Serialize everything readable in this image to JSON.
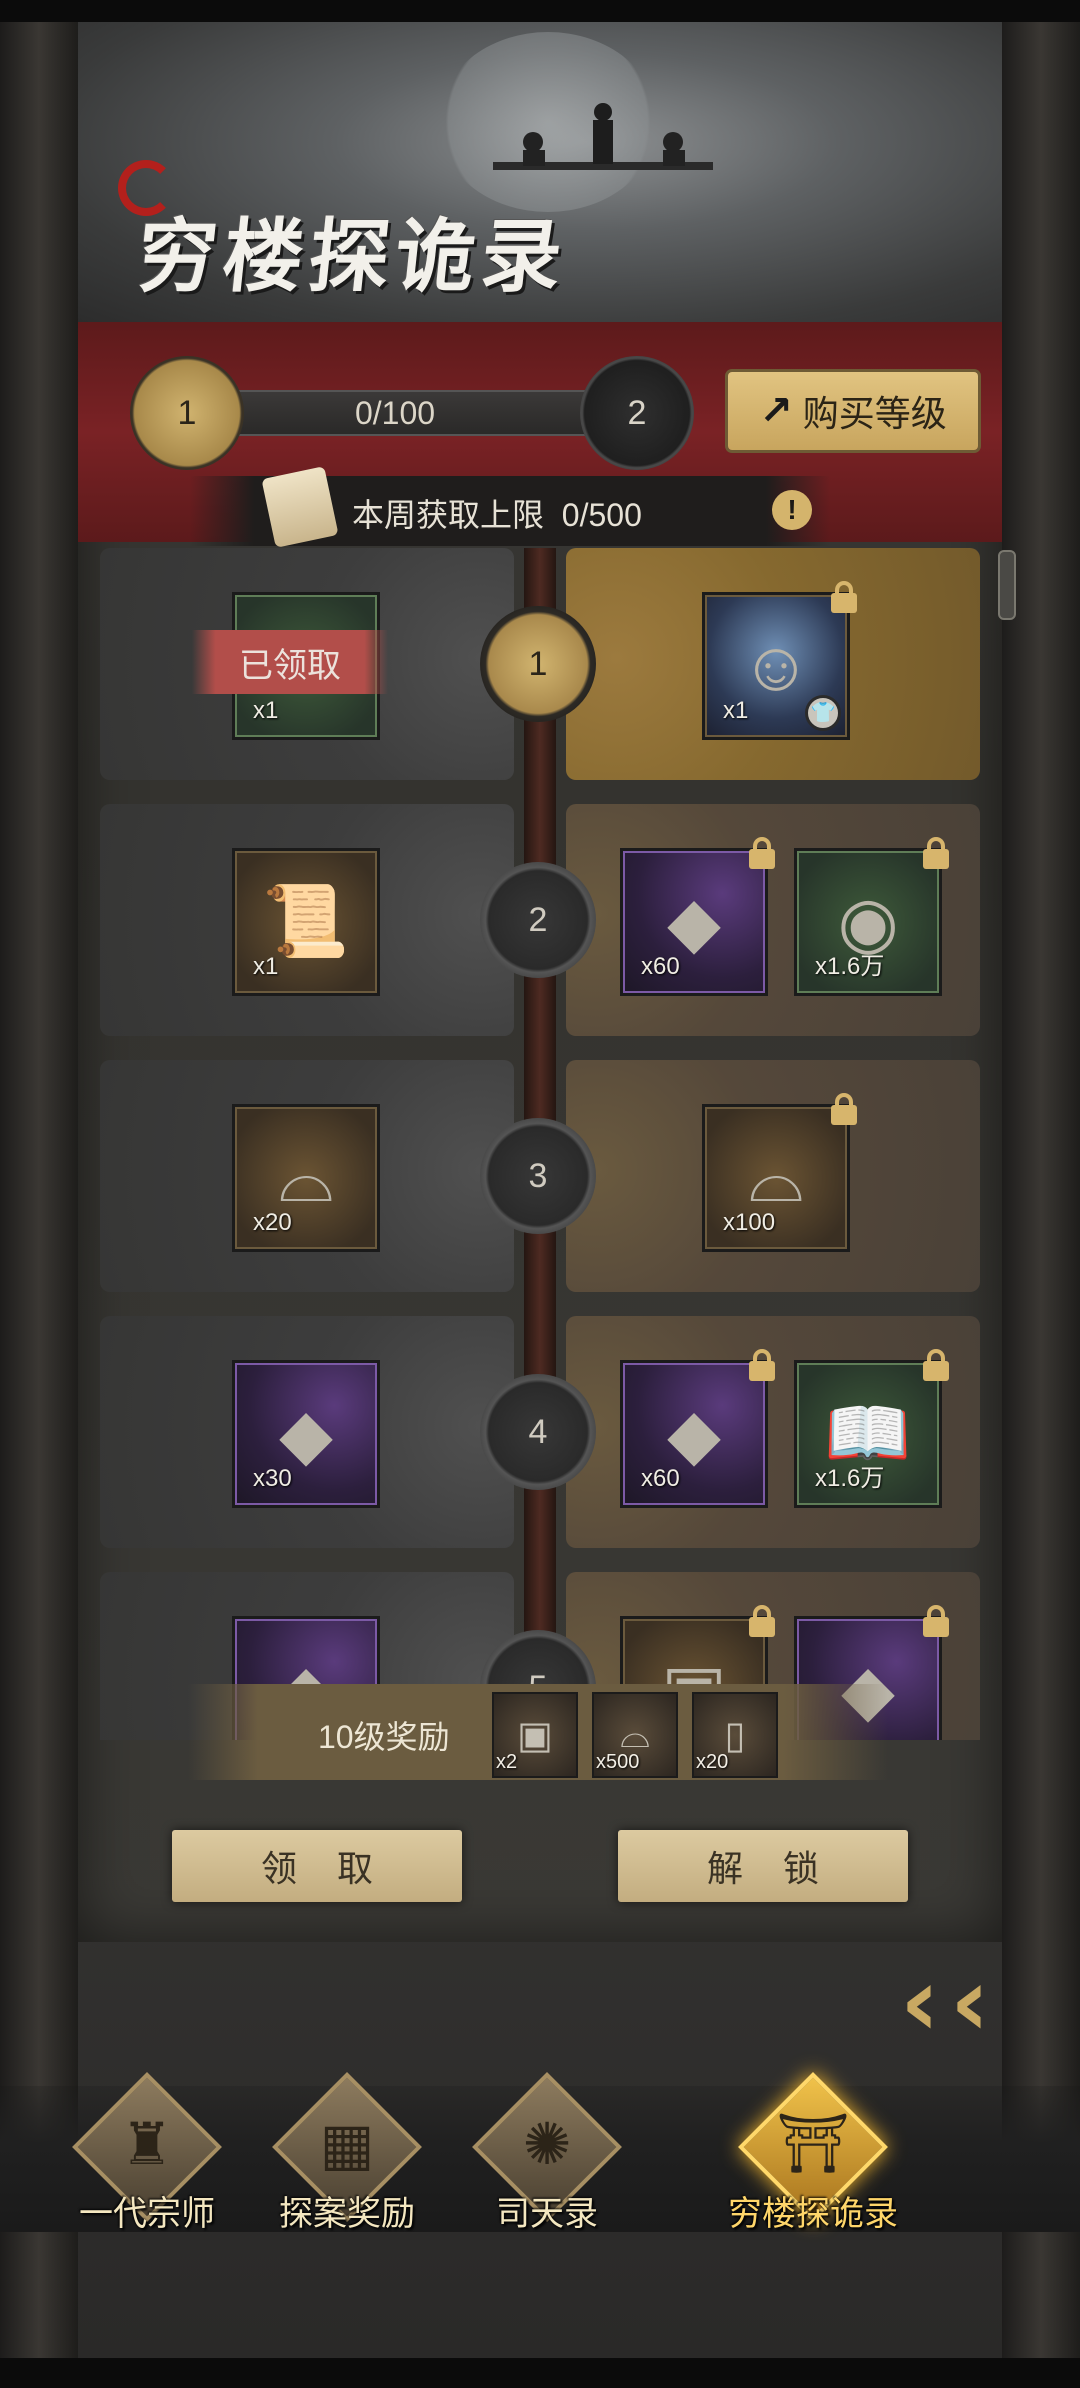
{
  "header": {
    "title": "穷楼探诡录"
  },
  "level": {
    "current": "1",
    "next": "2",
    "progress_text": "0/100",
    "progress_fraction": 0.0,
    "buy_label": "购买等级"
  },
  "weekly": {
    "label": "本周获取上限",
    "value": "0/500"
  },
  "claimed_label": "已领取",
  "rows": [
    {
      "level": "1",
      "free": [
        {
          "qty": "x1",
          "icon": "equipment-pack-icon"
        }
      ],
      "paid": [
        {
          "qty": "x1",
          "icon": "character-portrait-icon"
        }
      ]
    },
    {
      "level": "2",
      "free": [
        {
          "qty": "x1",
          "icon": "scroll-map-icon"
        }
      ],
      "paid": [
        {
          "qty": "x60",
          "icon": "ore-stone-icon"
        },
        {
          "qty": "x1.6万",
          "icon": "copper-coin-icon"
        }
      ]
    },
    {
      "level": "3",
      "free": [
        {
          "qty": "x20",
          "icon": "silver-ingot-icon"
        }
      ],
      "paid": [
        {
          "qty": "x100",
          "icon": "silver-ingot-icon"
        }
      ]
    },
    {
      "level": "4",
      "free": [
        {
          "qty": "x30",
          "icon": "ore-stone-icon"
        }
      ],
      "paid": [
        {
          "qty": "x60",
          "icon": "ore-stone-icon"
        },
        {
          "qty": "x1.6万",
          "icon": "book-icon"
        }
      ]
    },
    {
      "level": "5"
    }
  ],
  "lv10": {
    "label": "10级奖励",
    "items": [
      {
        "qty": "x2",
        "icon": "token-tag-icon"
      },
      {
        "qty": "x500",
        "icon": "silver-ingot-icon"
      },
      {
        "qty": "x20",
        "icon": "scroll-roll-icon"
      }
    ]
  },
  "actions": {
    "claim": "领取",
    "unlock": "解锁"
  },
  "nav": [
    {
      "label": "一代宗师",
      "icon": "training-dummy-icon"
    },
    {
      "label": "探案奖励",
      "icon": "treasure-box-icon"
    },
    {
      "label": "司天录",
      "icon": "astrolabe-icon"
    },
    {
      "label": "穷楼探诡录",
      "icon": "pagoda-icon",
      "active": true
    }
  ],
  "colors": {
    "accent_gold": "#d7b56c",
    "band_red": "#7a2225",
    "claimed_red": "#b24e4a",
    "active_nav": "#ffd66a"
  }
}
